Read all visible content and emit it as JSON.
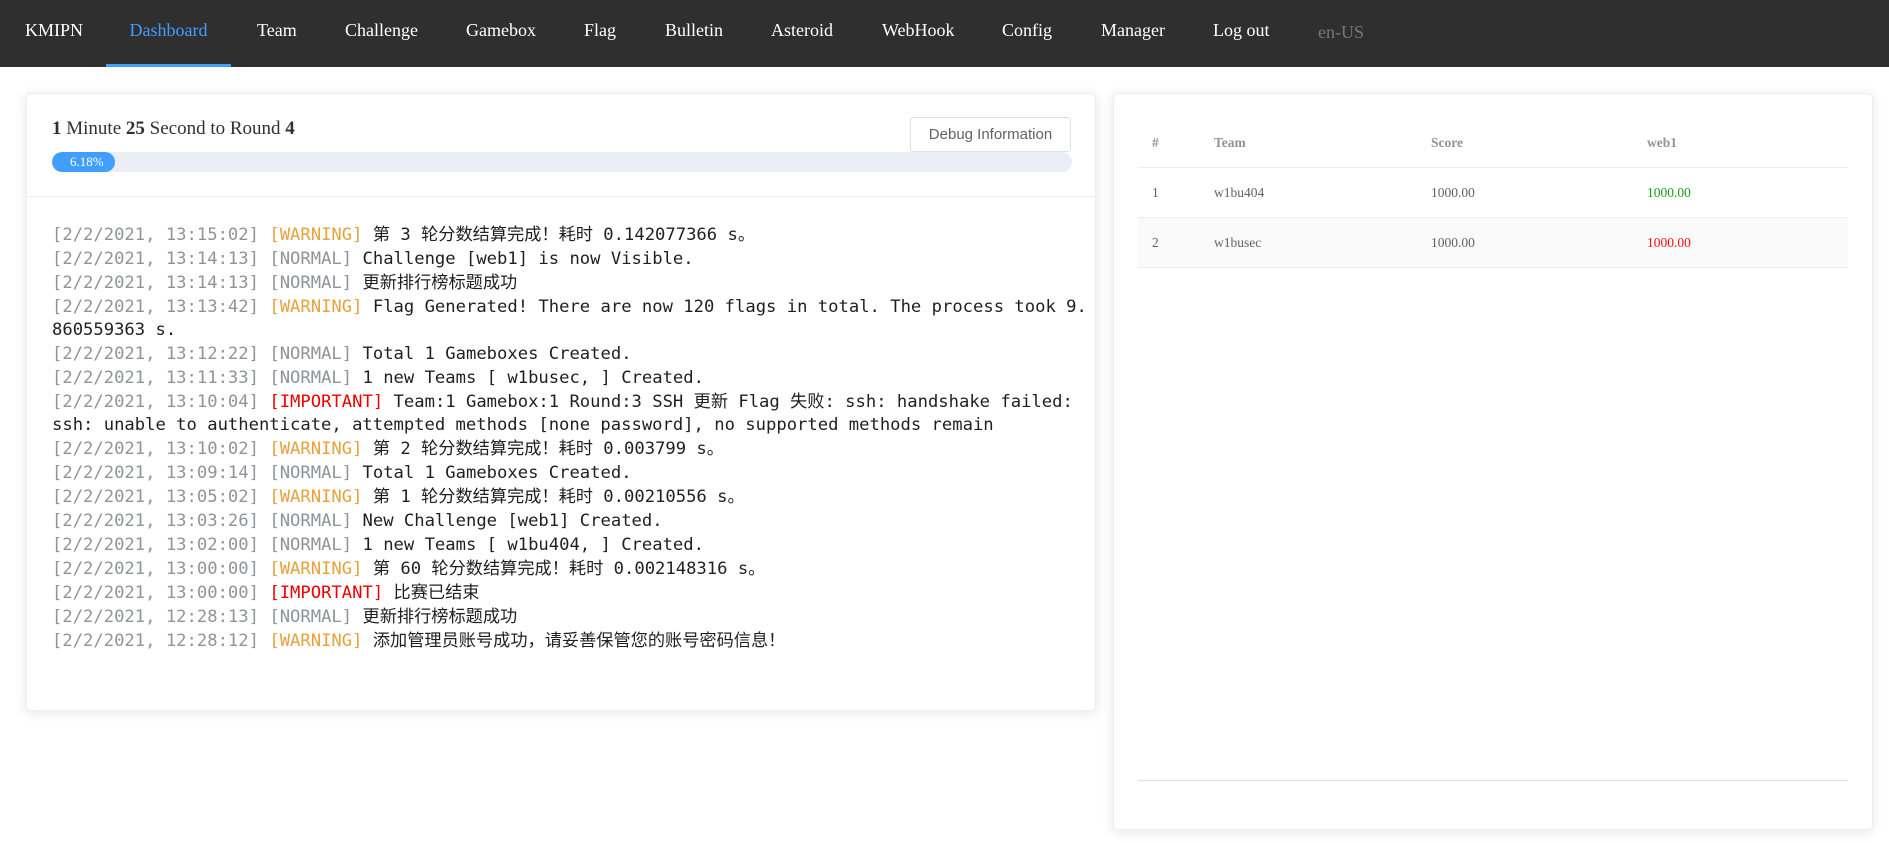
{
  "nav": {
    "brand": "KMIPN",
    "items": [
      {
        "label": "Dashboard",
        "active": true
      },
      {
        "label": "Team"
      },
      {
        "label": "Challenge"
      },
      {
        "label": "Gamebox"
      },
      {
        "label": "Flag"
      },
      {
        "label": "Bulletin"
      },
      {
        "label": "Asteroid"
      },
      {
        "label": "WebHook"
      },
      {
        "label": "Config"
      },
      {
        "label": "Manager"
      },
      {
        "label": "Log out"
      }
    ],
    "language": "en-US",
    "active_color": "#409eff"
  },
  "round_status": {
    "minutes": "1",
    "minute_label": "Minute",
    "seconds": "25",
    "second_label": "Second to Round",
    "round": "4",
    "progress_percent": 6.18,
    "progress_text": "6.18%",
    "debug_button": "Debug Information"
  },
  "logs": [
    {
      "time": "[2/2/2021, 13:15:02]",
      "level": "WARNING",
      "message": "第 3 轮分数结算完成！耗时 0.142077366 s。"
    },
    {
      "time": "[2/2/2021, 13:14:13]",
      "level": "NORMAL",
      "message": "Challenge [web1] is now Visible."
    },
    {
      "time": "[2/2/2021, 13:14:13]",
      "level": "NORMAL",
      "message": "更新排行榜标题成功"
    },
    {
      "time": "[2/2/2021, 13:13:42]",
      "level": "WARNING",
      "message": "Flag Generated! There are now 120 flags in total. The process took 9.860559363 s."
    },
    {
      "time": "[2/2/2021, 13:12:22]",
      "level": "NORMAL",
      "message": "Total 1 Gameboxes Created."
    },
    {
      "time": "[2/2/2021, 13:11:33]",
      "level": "NORMAL",
      "message": "1 new Teams [ w1busec, ] Created."
    },
    {
      "time": "[2/2/2021, 13:10:04]",
      "level": "IMPORTANT",
      "message": "Team:1 Gamebox:1 Round:3 SSH 更新 Flag 失败: ssh: handshake failed: ssh: unable to authenticate, attempted methods [none password], no supported methods remain"
    },
    {
      "time": "[2/2/2021, 13:10:02]",
      "level": "WARNING",
      "message": "第 2 轮分数结算完成！耗时 0.003799 s。"
    },
    {
      "time": "[2/2/2021, 13:09:14]",
      "level": "NORMAL",
      "message": "Total 1 Gameboxes Created."
    },
    {
      "time": "[2/2/2021, 13:05:02]",
      "level": "WARNING",
      "message": "第 1 轮分数结算完成！耗时 0.00210556 s。"
    },
    {
      "time": "[2/2/2021, 13:03:26]",
      "level": "NORMAL",
      "message": "New Challenge [web1] Created."
    },
    {
      "time": "[2/2/2021, 13:02:00]",
      "level": "NORMAL",
      "message": "1 new Teams [ w1bu404, ] Created."
    },
    {
      "time": "[2/2/2021, 13:00:00]",
      "level": "WARNING",
      "message": "第 60 轮分数结算完成！耗时 0.002148316 s。"
    },
    {
      "time": "[2/2/2021, 13:00:00]",
      "level": "IMPORTANT",
      "message": "比赛已结束"
    },
    {
      "time": "[2/2/2021, 12:28:13]",
      "level": "NORMAL",
      "message": "更新排行榜标题成功"
    },
    {
      "time": "[2/2/2021, 12:28:12]",
      "level": "WARNING",
      "message": "添加管理员账号成功，请妥善保管您的账号密码信息！"
    }
  ],
  "level_colors": {
    "WARNING": "#e6a23c",
    "NORMAL": "#909399",
    "IMPORTANT": "#ee0000"
  },
  "rank": {
    "headers": {
      "index": "#",
      "team": "Team",
      "score": "Score",
      "challenge": "web1"
    },
    "rows": [
      {
        "index": "1",
        "team": "w1bu404",
        "score": "1000.00",
        "challenge_score": "1000.00",
        "trend": "up"
      },
      {
        "index": "2",
        "team": "w1busec",
        "score": "1000.00",
        "challenge_score": "1000.00",
        "trend": "down"
      }
    ],
    "trend_colors": {
      "up": "#1a9a1a",
      "down": "#ee1111"
    }
  }
}
